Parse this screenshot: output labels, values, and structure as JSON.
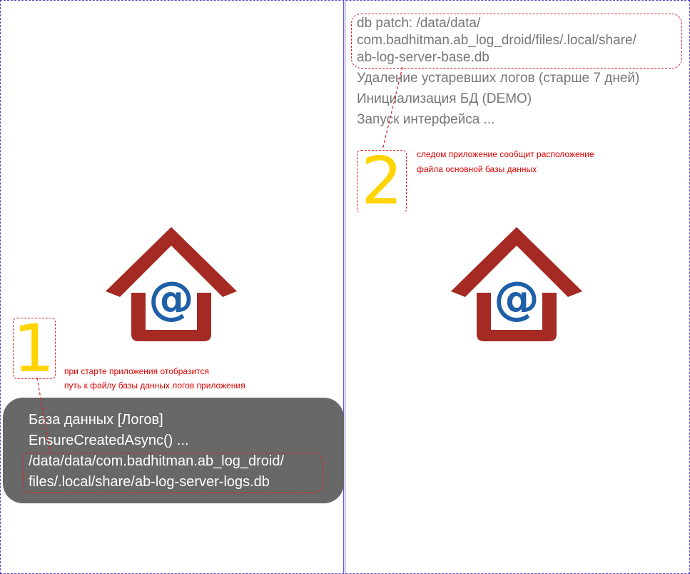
{
  "left_panel": {
    "marker_number": "1",
    "annotation": [
      "при старте приложения отобразится",
      "путь к файлу базы данных логов приложения"
    ],
    "toast": {
      "lines": [
        "База данных [Логов]",
        "EnsureCreatedAsync() ...",
        "/data/data/com.badhitman.ab_log_droid/",
        "files/.local/share/ab-log-server-logs.db"
      ]
    }
  },
  "right_panel": {
    "log_lines": [
      "db patch: /data/data/",
      "com.badhitman.ab_log_droid/files/.local/share/",
      "ab-log-server-base.db",
      "Удаление устаревших логов (старше 7 дней)",
      "Инициализация БД (DEMO)",
      "Запуск интерфейса ..."
    ],
    "marker_number": "2",
    "annotation": [
      "следом приложение сообщит расположение",
      "файла основной базы данных"
    ]
  },
  "colors": {
    "logo_red": "#a52a24",
    "logo_blue": "#1f5fa8",
    "annotation_red": "#e00000",
    "marker_yellow": "#ffd400",
    "toast_bg": "#686868"
  },
  "icons": {
    "app_logo": "house-with-at-sign-icon"
  }
}
